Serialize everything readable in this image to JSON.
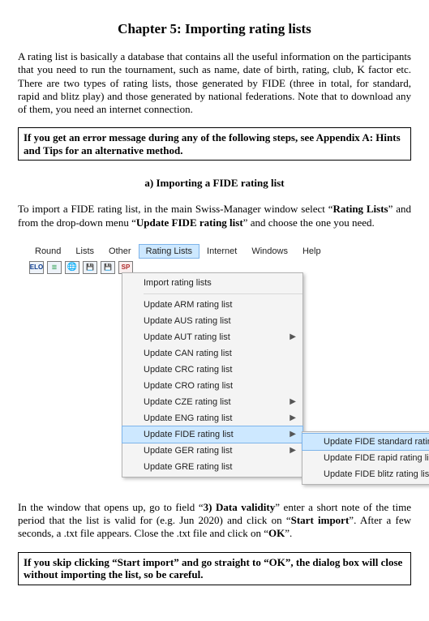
{
  "title": "Chapter 5: Importing rating lists",
  "intro": "A rating list is basically a database that contains all the useful information on the participants that you need to run the tournament, such as name, date of birth, rating, club, K factor etc. There are two types of rating lists, those generated by FIDE (three in total, for standard, rapid and blitz play) and those generated by national federations. Note that to download any of them, you need an internet connection.",
  "callout1": "If you get an error message during any of the following steps, see Appendix A: Hints and Tips for an alternative method.",
  "sectionA": "a) Importing a FIDE rating list",
  "paraA": {
    "pre": "To import a FIDE rating list, in the main Swiss-Manager window select “",
    "b1": "Rating Lists",
    "mid": "” and from the drop-down menu “",
    "b2": "Update FIDE rating list",
    "post": "” and choose the one you need."
  },
  "menubar": {
    "items": [
      "Round",
      "Lists",
      "Other",
      "Rating Lists",
      "Internet",
      "Windows",
      "Help"
    ],
    "selectedIndex": 3
  },
  "toolbar": {
    "elo": "ELO",
    "sheet": "≣",
    "world": "🌐",
    "disk1": "💾",
    "disk2": "💾",
    "sp": "SP"
  },
  "dropdown": {
    "top": "Import rating lists",
    "items": [
      {
        "label": "Update ARM rating list",
        "arrow": false
      },
      {
        "label": "Update AUS rating list",
        "arrow": false
      },
      {
        "label": "Update AUT rating list",
        "arrow": true
      },
      {
        "label": "Update CAN rating list",
        "arrow": false
      },
      {
        "label": "Update CRC rating list",
        "arrow": false
      },
      {
        "label": "Update CRO rating list",
        "arrow": false
      },
      {
        "label": "Update CZE rating list",
        "arrow": true
      },
      {
        "label": "Update ENG rating list",
        "arrow": true
      },
      {
        "label": "Update FIDE rating list",
        "arrow": true,
        "hot": true
      },
      {
        "label": "Update GER rating list",
        "arrow": true
      },
      {
        "label": "Update GRE rating list",
        "arrow": false
      }
    ]
  },
  "submenu": {
    "items": [
      {
        "label": "Update FIDE standard rating list",
        "hot": true
      },
      {
        "label": "Update FIDE rapid rating list"
      },
      {
        "label": "Update FIDE blitz rating list"
      }
    ]
  },
  "paraB": {
    "p1": "In the window that opens up, go to field “",
    "b1": "3) Data validity",
    "p2": "” enter a short note of the time period that the list is valid for (e.g. Jun 2020) and click on “",
    "b2": "Start import",
    "p3": "”. After a few seconds, a .txt file appears. Close the .txt file and click on “",
    "b3": "OK",
    "p4": "”."
  },
  "callout2": "If you skip clicking “Start import” and go straight to “OK”, the dialog box will close without importing the list, so be careful."
}
